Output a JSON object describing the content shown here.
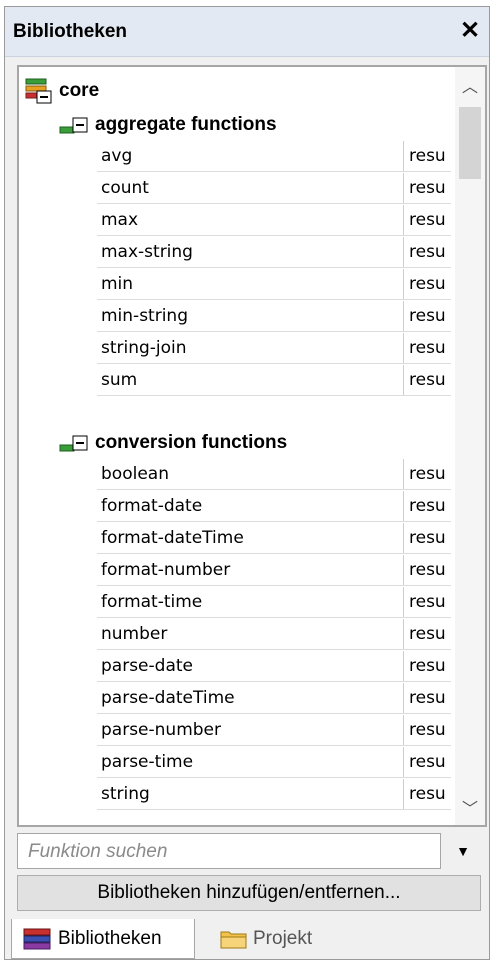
{
  "panel": {
    "title": "Bibliotheken",
    "close_glyph": "✕"
  },
  "tree": {
    "root": {
      "label": "core",
      "icon": "library-icon"
    },
    "groups": [
      {
        "label": "aggregate functions",
        "items": [
          {
            "name": "avg",
            "result": "resu"
          },
          {
            "name": "count",
            "result": "resu"
          },
          {
            "name": "max",
            "result": "resu"
          },
          {
            "name": "max-string",
            "result": "resu"
          },
          {
            "name": "min",
            "result": "resu"
          },
          {
            "name": "min-string",
            "result": "resu"
          },
          {
            "name": "string-join",
            "result": "resu"
          },
          {
            "name": "sum",
            "result": "resu"
          }
        ]
      },
      {
        "label": "conversion functions",
        "items": [
          {
            "name": "boolean",
            "result": "resu"
          },
          {
            "name": "format-date",
            "result": "resu"
          },
          {
            "name": "format-dateTime",
            "result": "resu"
          },
          {
            "name": "format-number",
            "result": "resu"
          },
          {
            "name": "format-time",
            "result": "resu"
          },
          {
            "name": "number",
            "result": "resu"
          },
          {
            "name": "parse-date",
            "result": "resu"
          },
          {
            "name": "parse-dateTime",
            "result": "resu"
          },
          {
            "name": "parse-number",
            "result": "resu"
          },
          {
            "name": "parse-time",
            "result": "resu"
          },
          {
            "name": "string",
            "result": "resu"
          }
        ]
      }
    ]
  },
  "search": {
    "placeholder": "Funktion suchen",
    "value": ""
  },
  "add_button": {
    "label": "Bibliotheken hinzufügen/entfernen..."
  },
  "tabs": [
    {
      "label": "Bibliotheken",
      "icon": "books-icon",
      "active": true
    },
    {
      "label": "Projekt",
      "icon": "folder-icon",
      "active": false
    }
  ],
  "colors": {
    "titlebar": "#e3e9f2",
    "panel_bg": "#f0f0f0",
    "button_bg": "#e1e1e1",
    "folder": "#f2c14e"
  }
}
